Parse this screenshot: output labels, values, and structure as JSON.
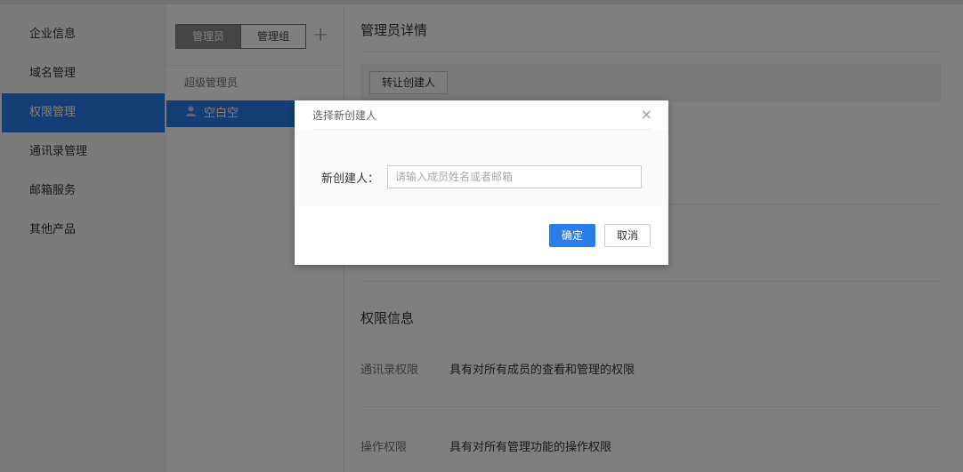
{
  "sidebar": {
    "items": [
      {
        "label": "企业信息",
        "active": false
      },
      {
        "label": "域名管理",
        "active": false
      },
      {
        "label": "权限管理",
        "active": true
      },
      {
        "label": "通讯录管理",
        "active": false
      },
      {
        "label": "邮箱服务",
        "active": false
      },
      {
        "label": "其他产品",
        "active": false
      }
    ]
  },
  "admin_panel": {
    "tabs": [
      "管理员",
      "管理组"
    ],
    "add_icon": "+",
    "group_label": "超级管理员",
    "member_icon": "person-icon",
    "member_name": "空白空"
  },
  "detail": {
    "title": "管理员详情",
    "transfer_button": "转让创建人",
    "permission_title": "权限信息",
    "permissions": [
      {
        "label": "通讯录权限",
        "value": "具有对所有成员的查看和管理的权限"
      },
      {
        "label": "操作权限",
        "value": "具有对所有管理功能的操作权限"
      }
    ]
  },
  "dialog": {
    "title": "选择新创建人",
    "close_icon": "×",
    "field_label": "新创建人：",
    "input_placeholder": "请输入成员姓名或者邮箱",
    "input_value": "",
    "ok_label": "确定",
    "cancel_label": "取消"
  },
  "colors": {
    "accent": "#2b7de9",
    "overlay": "rgba(0,0,0,0.5)"
  }
}
